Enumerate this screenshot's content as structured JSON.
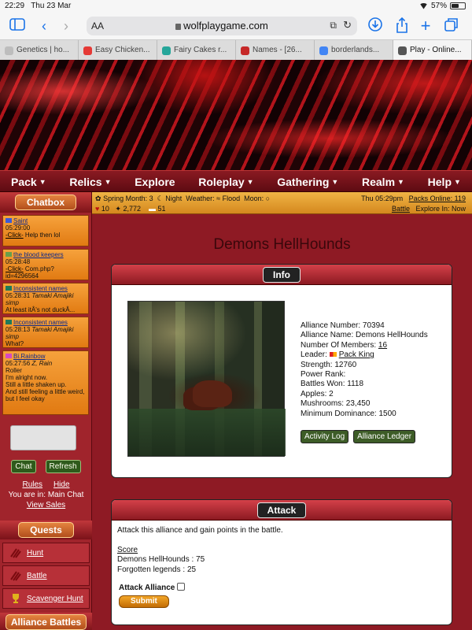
{
  "status_bar": {
    "time": "22:29",
    "date": "Thu 23 Mar",
    "battery": "57%",
    "battery_level": 0.57
  },
  "browser": {
    "text_size_label": "AA",
    "url": "wolfplaygame.com",
    "tabs": [
      {
        "label": "Genetics | ho...",
        "favicon_color": "#bdbdbd"
      },
      {
        "label": "Easy Chicken...",
        "favicon_color": "#e53935"
      },
      {
        "label": "Fairy Cakes r...",
        "favicon_color": "#26a69a"
      },
      {
        "label": "Names - [26...",
        "favicon_color": "#c62828"
      },
      {
        "label": "borderlands...",
        "favicon_color": "#4285f4"
      },
      {
        "label": "Play - Online...",
        "favicon_color": "#555555"
      }
    ]
  },
  "nav": [
    {
      "label": "Pack",
      "caret": "▼"
    },
    {
      "label": "Relics",
      "caret": "▼"
    },
    {
      "label": "Explore",
      "caret": ""
    },
    {
      "label": "Roleplay",
      "caret": "▼"
    },
    {
      "label": "Gathering",
      "caret": "▼"
    },
    {
      "label": "Realm",
      "caret": "▼"
    },
    {
      "label": "Help",
      "caret": "▼"
    }
  ],
  "infobar": {
    "season": "Spring Month: 3",
    "time_of_day": "Night",
    "weather_label": "Weather:",
    "weather": "Flood",
    "moon_label": "Moon:",
    "stat1": "10",
    "stat2": "2,772",
    "stat3": "51",
    "clock": "Thu 05:29pm",
    "packs_online": "Packs Online: 119",
    "battle": "Battle",
    "explore_in": "Explore In: Now"
  },
  "sidebar": {
    "chatbox_title": "Chatbox",
    "messages": [
      {
        "name": "Saint",
        "time": "05:29:00",
        "link": "-Click-",
        "text": "Help then lol",
        "flag": "#3b5bd6"
      },
      {
        "name": "the blood keepers",
        "time": "05:28:48",
        "link": "-Click-",
        "text": "Com.php?id=4296564",
        "flag": "#6aa04a"
      },
      {
        "name": "Inconsistent names",
        "time": "05:28:31",
        "author": "Tamaki Amajiki simp",
        "text": "At least itÂ's not duckÂ...",
        "flag": "#1f7a5a"
      },
      {
        "name": "Inconsistent names",
        "time": "05:28:13",
        "author": "Tamaki Amajiki simp",
        "text": "What?",
        "flag": "#1f7a5a"
      },
      {
        "name": "Bi.Rainbow",
        "time": "05:27:56",
        "author": "Z, Rain",
        "text": "Roller",
        "lines": [
          "I'm alright now.",
          "Still a little shaken up.",
          "And still feeling a little weird,",
          "but I feel okay"
        ],
        "flag": "#d64ac0"
      }
    ],
    "chat_button": "Chat",
    "refresh_button": "Refresh",
    "rules": "Rules",
    "hide": "Hide",
    "location": "You are in: Main Chat",
    "view_sales": "View Sales",
    "quests_title": "Quests",
    "quests": [
      "Hunt",
      "Battle",
      "Scavenger Hunt"
    ],
    "alliance_title": "Alliance Battles"
  },
  "main": {
    "title": "Demons HellHounds",
    "info": {
      "header": "Info",
      "alliance_number": "Alliance Number: 70394",
      "alliance_name": "Alliance Name: Demons HellHounds",
      "members_label": "Number Of Members: ",
      "members": "16",
      "leader_label": "Leader: ",
      "leader": "Pack King",
      "strength": "Strength: 12760",
      "power_rank": "Power Rank:",
      "battles_won": "Battles Won: 1118",
      "apples": "Apples: 2",
      "mushrooms": "Mushrooms: 23,450",
      "min_dominance": "Minimum Dominance: 1500",
      "activity_log": "Activity Log",
      "alliance_ledger": "Alliance Ledger"
    },
    "attack": {
      "header": "Attack",
      "description": "Attack this alliance and gain points in the battle.",
      "score_label": "Score",
      "score1": "Demons HellHounds : 75",
      "score2": "Forgotten legends : 25",
      "checkbox_label": "Attack Alliance",
      "submit": "Submit"
    }
  }
}
